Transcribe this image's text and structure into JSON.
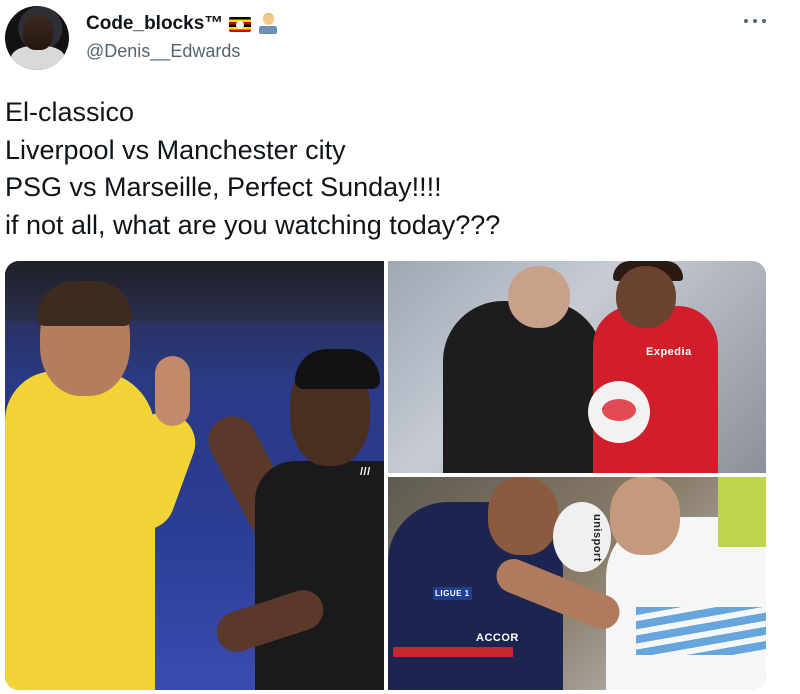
{
  "author": {
    "display_name": "Code_blocks™",
    "handle": "@Denis__Edwards",
    "badges": [
      "uganda-flag-icon",
      "technologist-emoji-icon"
    ]
  },
  "more_menu": {
    "icon": "more-horizontal-icon"
  },
  "tweet": {
    "lines": [
      "El-classico",
      "Liverpool vs Manchester city",
      "PSG vs Marseille, Perfect Sunday!!!!",
      "if not all, what are you watching today???"
    ]
  },
  "media": {
    "photos": [
      {
        "description_icon": "football-photo-el-clasico"
      },
      {
        "description_icon": "football-photo-liverpool-city"
      },
      {
        "description_icon": "football-photo-psg-marseille"
      }
    ],
    "visible_marks": {
      "expedia": "Expedia",
      "unisport": "unisport",
      "accor": "ACCOR",
      "adidas_stripes": "///",
      "ligue": "LIGUE 1"
    }
  },
  "colors": {
    "text": "#0f1419",
    "secondary": "#536471",
    "background": "#ffffff"
  }
}
